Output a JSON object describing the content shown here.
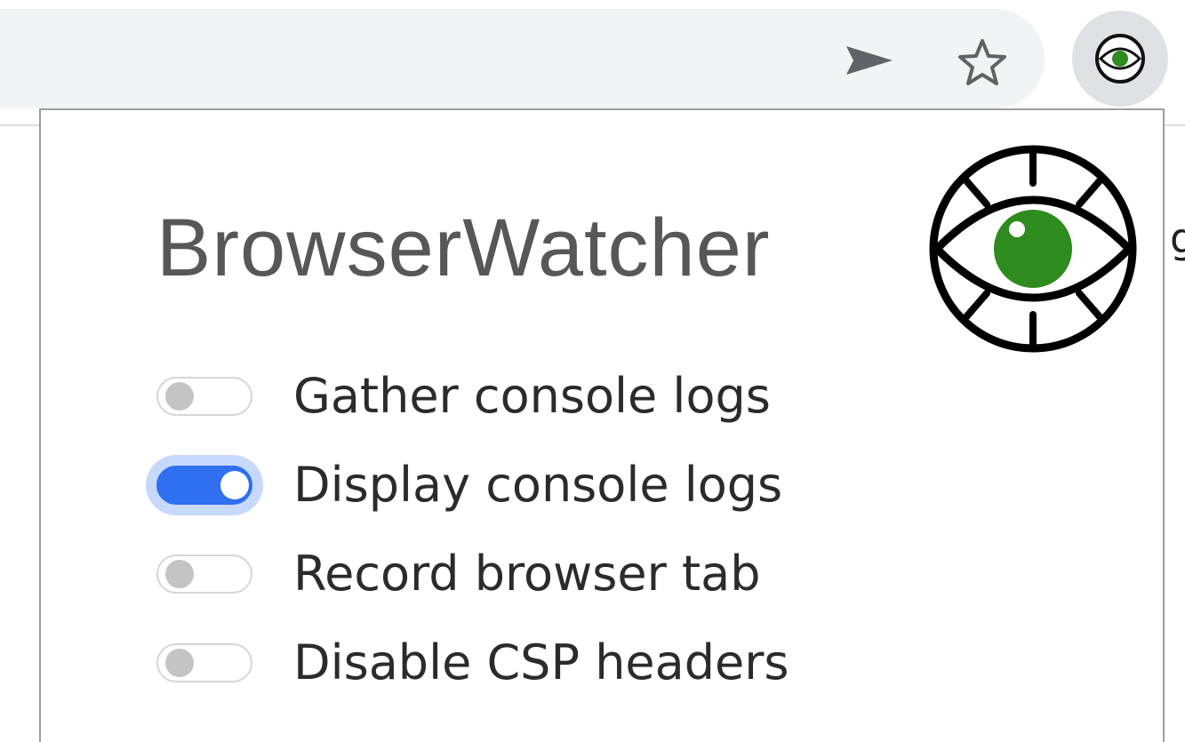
{
  "toolbar": {
    "icons": [
      "send-icon",
      "star-icon",
      "browserwatcher-extension-icon"
    ]
  },
  "popup": {
    "title": "BrowserWatcher",
    "logo": "browserwatcher-eye-logo",
    "colors": {
      "title": "#575757",
      "logo_iris": "#2e8b1e",
      "toggle_on": "#2f6ff0",
      "toggle_off_knob": "#c4c4c4"
    },
    "options": [
      {
        "label": "Gather console logs",
        "enabled": false
      },
      {
        "label": "Display console logs",
        "enabled": true
      },
      {
        "label": "Record browser tab",
        "enabled": false
      },
      {
        "label": "Disable CSP headers",
        "enabled": false
      }
    ]
  },
  "background": {
    "fragment": "ge"
  }
}
